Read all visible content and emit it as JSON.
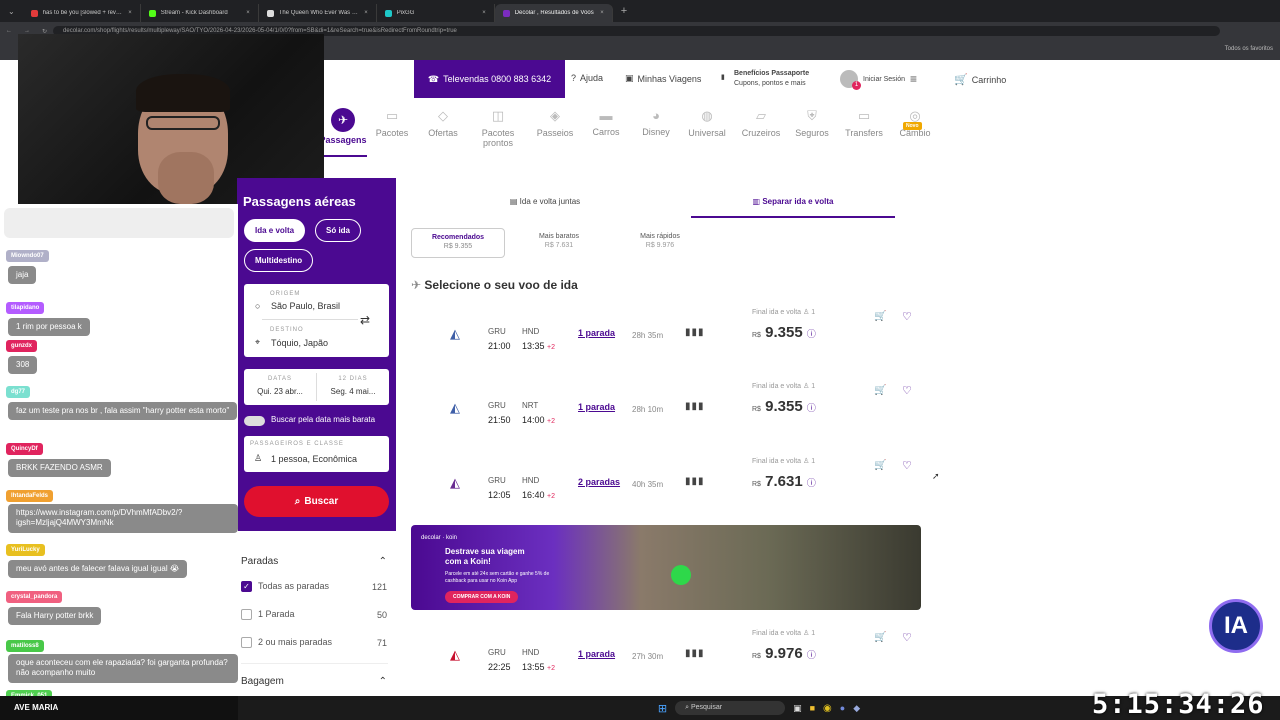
{
  "browser": {
    "tabs": [
      {
        "title": "has to be you [slowed + reverb]",
        "color": "#e23b3b",
        "active": false
      },
      {
        "title": "Stream - Kick Dashboard",
        "color": "#53fc18",
        "active": false
      },
      {
        "title": "The Queen Who Ever Was • HBO",
        "color": "#dddddd",
        "active": false
      },
      {
        "title": "PixGG",
        "color": "#1ec8c8",
        "active": false
      },
      {
        "title": "Decolar , Resultados de Voos",
        "color": "#7b2cbf",
        "active": true
      }
    ],
    "url": "decolar.com/shop/flights/results/multipleway/SAO/TYO/2026-04-23/2026-05-04/1/0/0?from=SB&di=1&reSearch=true&isRedirectFromRoundtrip=true",
    "bookmarks_label": "Todos os favoritos"
  },
  "header": {
    "phone": "Televendas 0800 883 6342",
    "help": "Ajuda",
    "trips": "Minhas Viagens",
    "benefits_title": "Benefícios Passaporte",
    "benefits_sub": "Cupons, pontos e mais",
    "login": "Iniciar Sesión",
    "login_badge": "1",
    "cart": "Carrinho"
  },
  "products": [
    {
      "label": "Passagens",
      "icon": "plane-icon"
    },
    {
      "label": "Pacotes",
      "icon": "suitcase-icon"
    },
    {
      "label": "Ofertas",
      "icon": "tag-icon"
    },
    {
      "label": "Pacotes prontos",
      "icon": "box-icon"
    },
    {
      "label": "Passeios",
      "icon": "ticket-icon"
    },
    {
      "label": "Carros",
      "icon": "car-icon"
    },
    {
      "label": "Disney",
      "icon": "mickey-icon"
    },
    {
      "label": "Universal",
      "icon": "globe-icon"
    },
    {
      "label": "Cruzeiros",
      "icon": "ship-icon"
    },
    {
      "label": "Seguros",
      "icon": "shield-icon"
    },
    {
      "label": "Transfers",
      "icon": "bus-icon"
    },
    {
      "label": "Câmbio",
      "icon": "coin-icon",
      "badge": "Novo"
    }
  ],
  "search": {
    "title": "Passagens aéreas",
    "trip_roundtrip": "Ida e volta",
    "trip_oneway": "Só ida",
    "trip_multi": "Multidestino",
    "origin_label": "ORIGEM",
    "origin_value": "São Paulo, Brasil",
    "dest_label": "DESTINO",
    "dest_value": "Tóquio, Japão",
    "dates_label": "DATAS",
    "date_out": "Qui. 23 abr...",
    "nights_label": "12 DIAS",
    "date_back": "Seg. 4 mai...",
    "cheapest_toggle": "Buscar pela data mais barata",
    "pax_label": "PASSAGEIROS E CLASSE",
    "pax_value": "1 pessoa, Econômica",
    "search_button": "Buscar"
  },
  "results": {
    "mode_joint": "Ida e volta juntas",
    "mode_split": "Separar ida e volta",
    "sort": [
      {
        "label": "Recomendados",
        "price": "R$ 9.355"
      },
      {
        "label": "Mais baratos",
        "price": "R$ 7.631"
      },
      {
        "label": "Mais rápidos",
        "price": "R$ 9.976"
      }
    ],
    "heading": "Selecione o seu voo de ida",
    "final_label": "Final ida e volta",
    "pax_count": "1",
    "currency": "R$",
    "flights": [
      {
        "from": "GRU",
        "dep": "21:00",
        "to": "HND",
        "arr": "13:35",
        "plus": "+2",
        "stops": "1 parada",
        "duration": "28h 35m",
        "price": "9.355",
        "airline_color": "#3f5fa8"
      },
      {
        "from": "GRU",
        "dep": "21:50",
        "to": "NRT",
        "arr": "14:00",
        "plus": "+2",
        "stops": "1 parada",
        "duration": "28h 10m",
        "price": "9.355",
        "airline_color": "#3f5fa8"
      },
      {
        "from": "GRU",
        "dep": "12:05",
        "to": "HND",
        "arr": "16:40",
        "plus": "+2",
        "stops": "2 paradas",
        "duration": "40h 35m",
        "price": "7.631",
        "airline_color": "#6a2c91"
      },
      {
        "from": "GRU",
        "dep": "22:25",
        "to": "HND",
        "arr": "13:55",
        "plus": "+2",
        "stops": "1 parada",
        "duration": "27h 30m",
        "price": "9.976",
        "airline_color": "#c8102e"
      }
    ],
    "banner": {
      "brand": "decolar · koin",
      "title": "Destrave sua viagem com a Koin!",
      "sub": "Parcele em até 24x sem cartão e ganhe 5% de cashback para usar no Koin App",
      "cta": "COMPRAR COM A KOIN"
    }
  },
  "filters": {
    "stops_title": "Paradas",
    "options": [
      {
        "label": "Todas as paradas",
        "count": "121",
        "checked": true
      },
      {
        "label": "1 Parada",
        "count": "50",
        "checked": false
      },
      {
        "label": "2 ou mais paradas",
        "count": "71",
        "checked": false
      }
    ],
    "baggage_title": "Bagagem"
  },
  "chat": {
    "messages": [
      {
        "user": "Miowndo07",
        "text": "jaja",
        "color": "#b0b0c8"
      },
      {
        "user": "tilapidano",
        "text": "1 rim por pessoa k",
        "color": "#b45cff"
      },
      {
        "user": "gunzdx",
        "text": "308",
        "color": "#e0245e"
      },
      {
        "user": "dg77",
        "text": "faz um teste pra nos br , fala assim \"harry potter esta morto\"",
        "color": "#7be0d0"
      },
      {
        "user": "QuincyDf",
        "text": "BRKK FAZENDO ASMR",
        "color": "#e0245e"
      },
      {
        "user": "lhtandaFelds",
        "text": "https://www.instagram.com/p/DVhmMfADbv2/?igsh=MzljajQ4MWY3MmNk",
        "color": "#f0a030"
      },
      {
        "user": "YuriLucky",
        "text": "meu avó antes de falecer falava igual igual 😭",
        "color": "#e8c020"
      },
      {
        "user": "crystal_pandora",
        "text": "Fala Harry potter brkk",
        "color": "#f06080"
      },
      {
        "user": "matiloss8",
        "text": "oque aconteceu com ele rapaziada? foi garganta profunda? não acompanho muito",
        "color": "#48c848"
      },
      {
        "user": "Emmick_051",
        "text": "",
        "color": "#50d050"
      }
    ],
    "footer": "AVE MARIA"
  },
  "taskbar": {
    "search": "Pesquisar"
  },
  "overlay": {
    "timer": "5:15:34:26",
    "ia_logo": "IA"
  }
}
